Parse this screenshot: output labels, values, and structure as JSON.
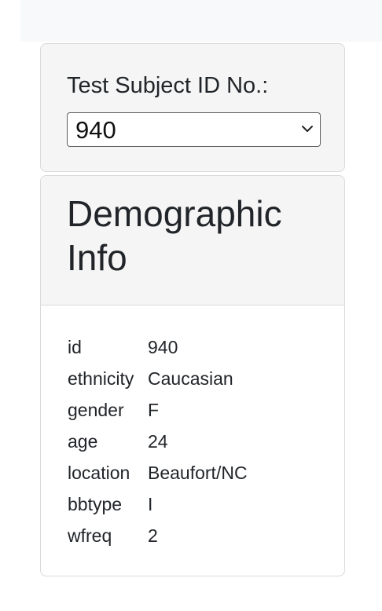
{
  "selector": {
    "label": "Test Subject ID No.:",
    "selected_value": "940"
  },
  "demographic_panel": {
    "title": "Demographic Info",
    "rows": [
      {
        "key": "id",
        "value": "940"
      },
      {
        "key": "ethnicity",
        "value": "Caucasian"
      },
      {
        "key": "gender",
        "value": "F"
      },
      {
        "key": "age",
        "value": "24"
      },
      {
        "key": "location",
        "value": "Beaufort/NC"
      },
      {
        "key": "bbtype",
        "value": "I"
      },
      {
        "key": "wfreq",
        "value": "2"
      }
    ]
  },
  "icons": {
    "select_chevron": "chevron-down-icon"
  }
}
